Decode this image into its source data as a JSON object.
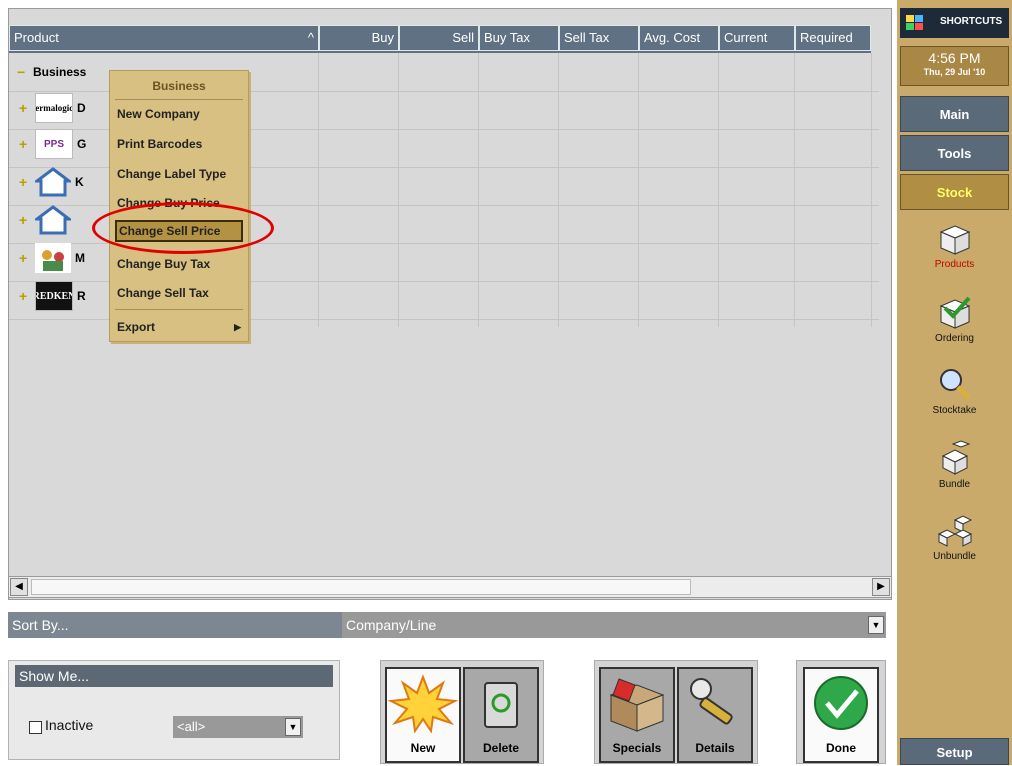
{
  "table": {
    "columns": [
      "Product",
      "Buy",
      "Sell",
      "Buy Tax",
      "Sell Tax",
      "Avg. Cost",
      "Current",
      "Required"
    ],
    "sort_indicator": "^",
    "root": "Business",
    "rows": [
      {
        "logo": "dermalogica",
        "label": "D"
      },
      {
        "logo": "PPS",
        "label": "G"
      },
      {
        "logo": "",
        "label": "K"
      },
      {
        "logo": "",
        "label": ""
      },
      {
        "logo": "",
        "label": "M"
      },
      {
        "logo": "REDKEN",
        "label": "R"
      }
    ]
  },
  "context_menu": {
    "title": "Business",
    "items": [
      "New Company",
      "Print Barcodes",
      "Change Label Type",
      "Change Buy Price",
      "Change Sell Price",
      "Change Buy Tax",
      "Change Sell Tax"
    ],
    "export": "Export",
    "selected": "Change Sell Price"
  },
  "sort": {
    "label": "Sort By...",
    "value": "Company/Line"
  },
  "show_me": {
    "label": "Show Me...",
    "inactive": "Inactive",
    "filter": "<all>"
  },
  "buttons": {
    "new": "New",
    "delete": "Delete",
    "specials": "Specials",
    "details": "Details",
    "done": "Done"
  },
  "sidebar": {
    "shortcuts": "SHORTCUTS",
    "time": "4:56 PM",
    "date": "Thu, 29 Jul '10",
    "main": "Main",
    "tools": "Tools",
    "stock": "Stock",
    "setup": "Setup",
    "items": [
      "Products",
      "Ordering",
      "Stocktake",
      "Bundle",
      "Unbundle"
    ]
  }
}
